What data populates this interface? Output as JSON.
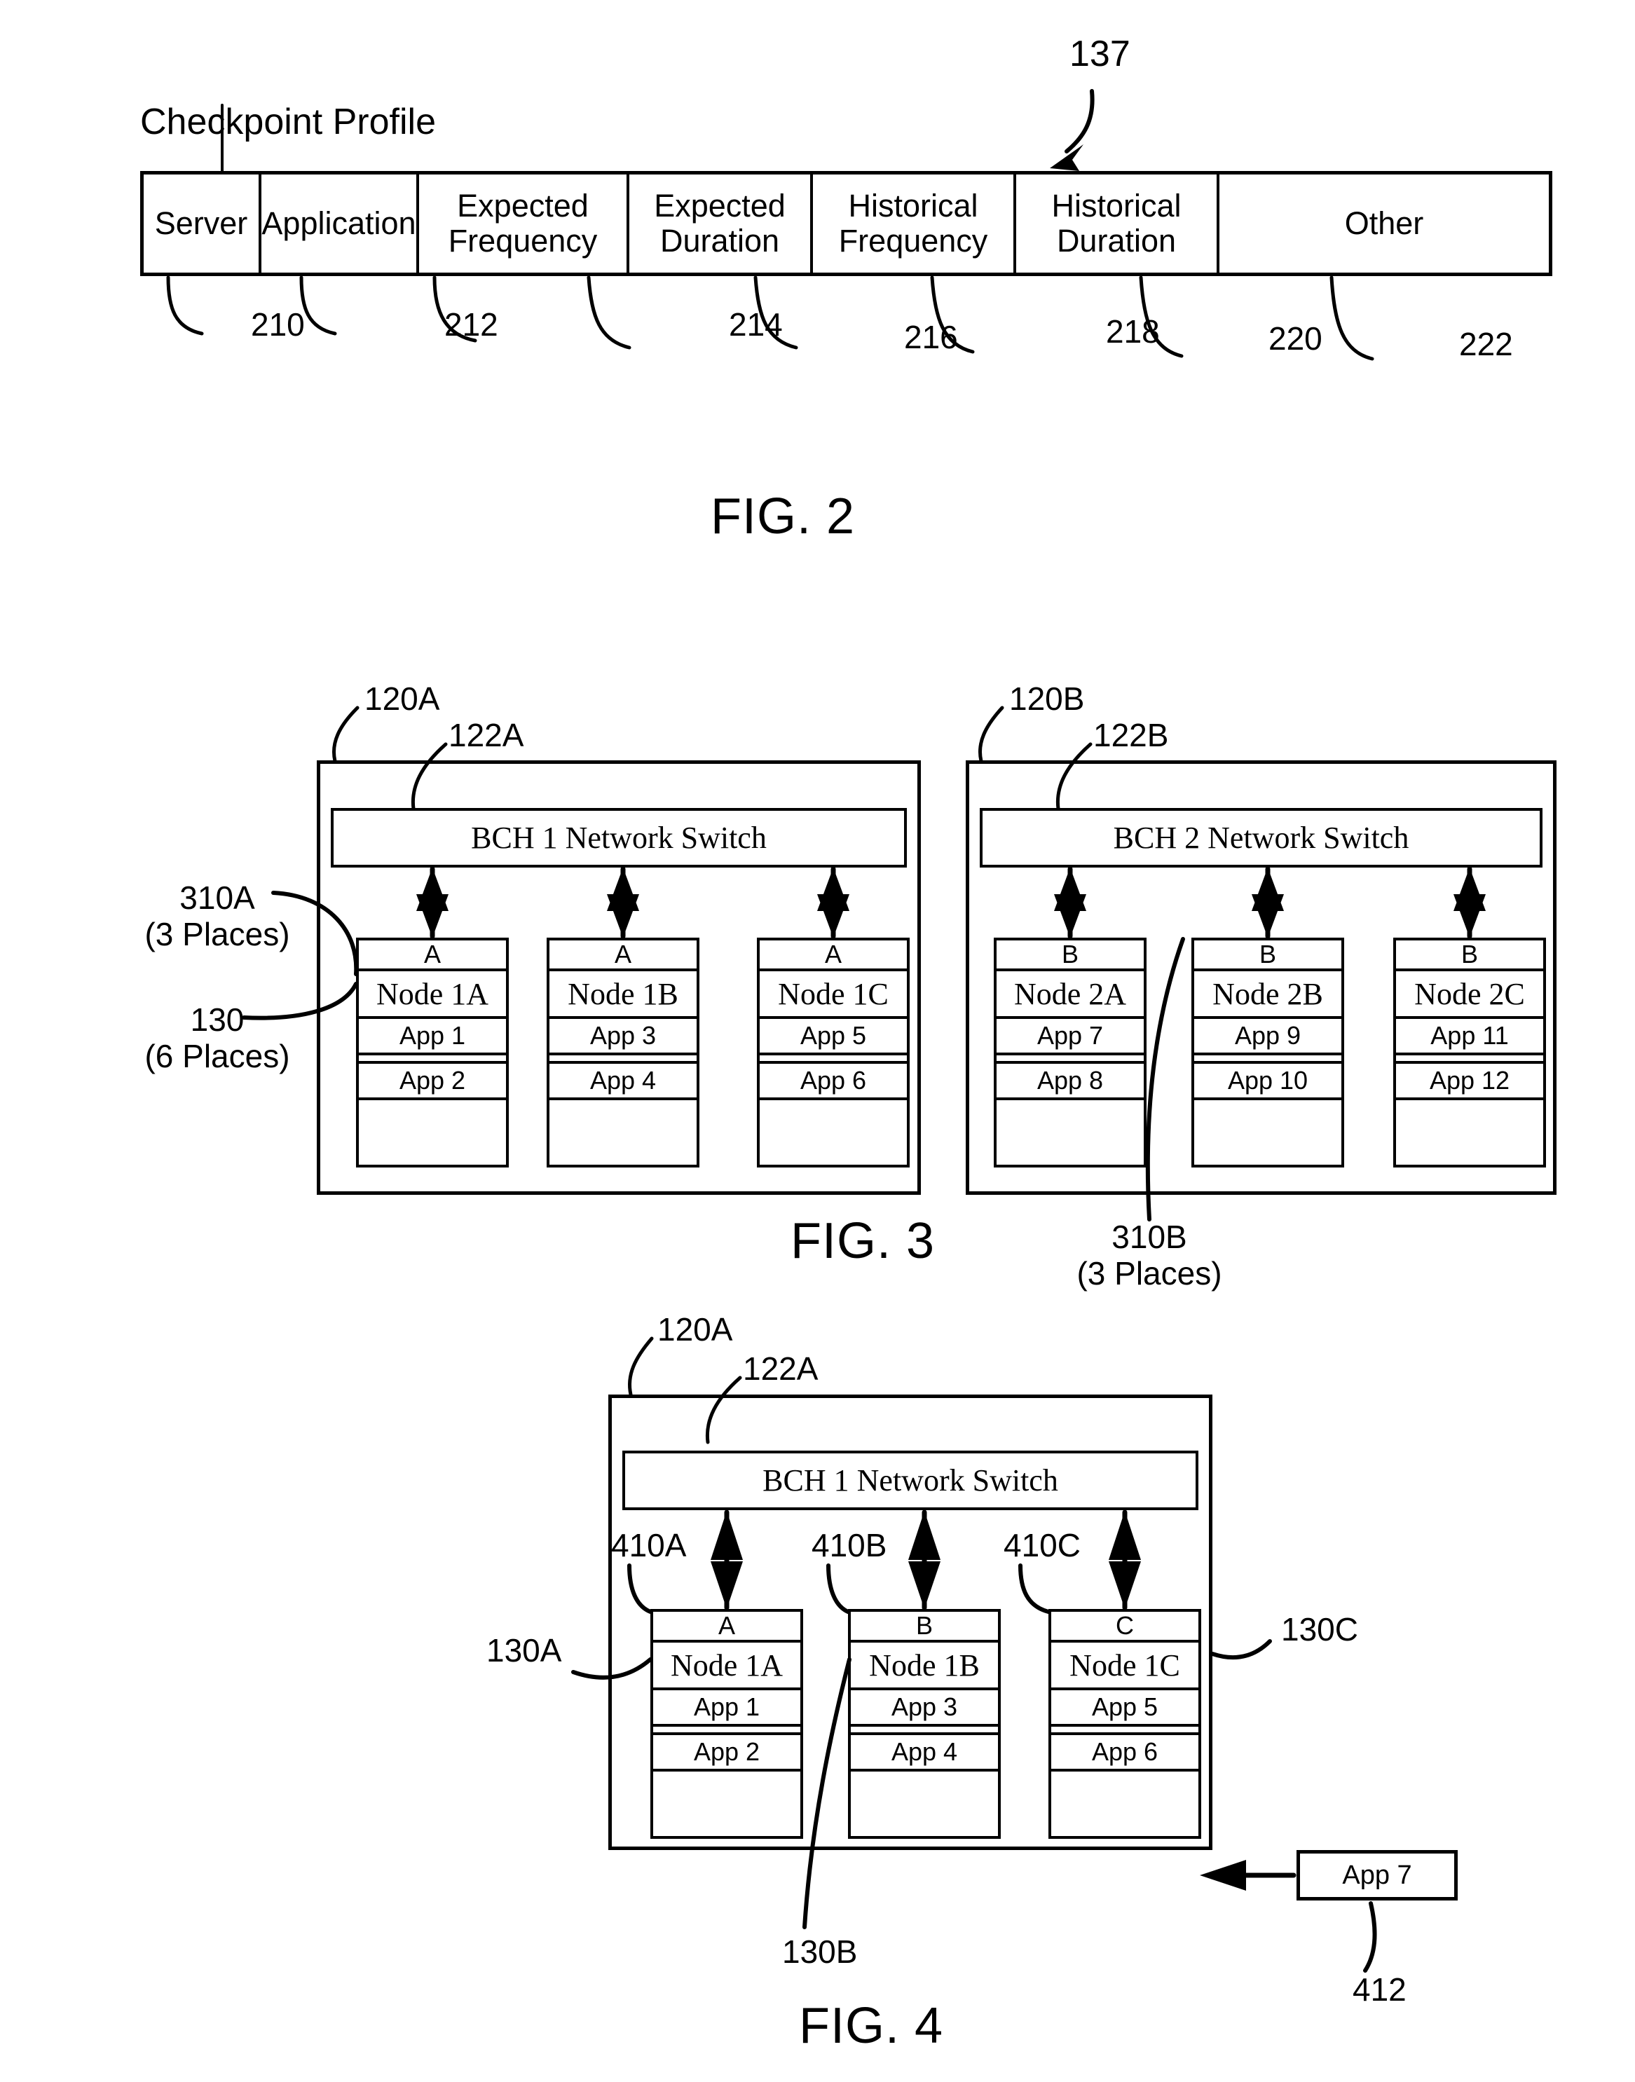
{
  "figures": [
    {
      "id": "fig2",
      "label": "FIG. 2",
      "title": "Checkpoint Profile",
      "callout": "137",
      "columns": [
        {
          "label": "Server",
          "ref": "210"
        },
        {
          "label": "Application",
          "ref": "212"
        },
        {
          "label": "Expected\nFrequency",
          "ref": "214"
        },
        {
          "label": "Expected\nDuration",
          "ref": "216"
        },
        {
          "label": "Historical\nFrequency",
          "ref": "218"
        },
        {
          "label": "Historical\nDuration",
          "ref": "220"
        },
        {
          "label": "Other",
          "ref": "222"
        }
      ]
    },
    {
      "id": "fig3",
      "label": "FIG. 3",
      "annotations": {
        "left_upper": "310A\n(3 Places)",
        "left_lower": "130\n(6 Places)",
        "right_lower": "310B\n(3 Places)"
      },
      "chassis": [
        {
          "ref": "120A",
          "switch_ref": "122A",
          "switch_label": "BCH 1 Network Switch",
          "nodes": [
            {
              "header": "A",
              "name": "Node 1A",
              "apps": [
                "App 1",
                "App 2"
              ]
            },
            {
              "header": "A",
              "name": "Node 1B",
              "apps": [
                "App 3",
                "App 4"
              ]
            },
            {
              "header": "A",
              "name": "Node 1C",
              "apps": [
                "App 5",
                "App 6"
              ]
            }
          ]
        },
        {
          "ref": "120B",
          "switch_ref": "122B",
          "switch_label": "BCH 2 Network Switch",
          "nodes": [
            {
              "header": "B",
              "name": "Node 2A",
              "apps": [
                "App 7",
                "App 8"
              ]
            },
            {
              "header": "B",
              "name": "Node 2B",
              "apps": [
                "App 9",
                "App 10"
              ]
            },
            {
              "header": "B",
              "name": "Node 2C",
              "apps": [
                "App 11",
                "App 12"
              ]
            }
          ]
        }
      ]
    },
    {
      "id": "fig4",
      "label": "FIG. 4",
      "chassis_ref": "120A",
      "switch_ref": "122A",
      "switch_label": "BCH 1 Network Switch",
      "link_refs": [
        "410A",
        "410B",
        "410C"
      ],
      "node_refs": [
        "130A",
        "130B",
        "130C"
      ],
      "nodes": [
        {
          "header": "A",
          "name": "Node 1A",
          "apps": [
            "App 1",
            "App 2"
          ]
        },
        {
          "header": "B",
          "name": "Node 1B",
          "apps": [
            "App 3",
            "App 4"
          ]
        },
        {
          "header": "C",
          "name": "Node 1C",
          "apps": [
            "App 5",
            "App 6"
          ]
        }
      ],
      "incoming_app": {
        "label": "App 7",
        "ref": "412"
      }
    }
  ]
}
